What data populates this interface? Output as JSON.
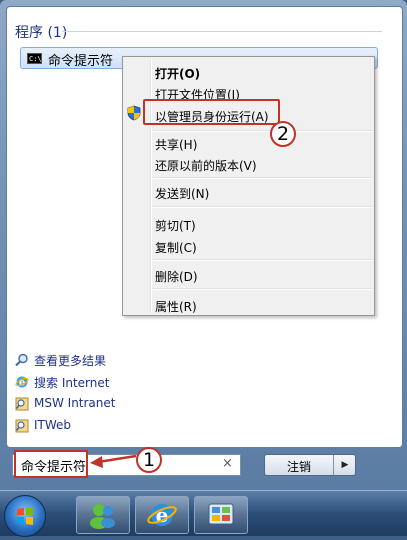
{
  "start_menu": {
    "section_header": "程序 (1)",
    "program_item": {
      "label": "命令提示符",
      "icon_text": "C:\\"
    }
  },
  "context_menu": {
    "items": [
      {
        "label": "打开(O)",
        "bold": true
      },
      {
        "label": "打开文件位置(I)"
      },
      {
        "label": "以管理员身份运行(A)",
        "icon": "uac-shield-icon",
        "highlighted": true
      },
      {
        "label": "共享(H)"
      },
      {
        "label": "还原以前的版本(V)"
      },
      {
        "label": "发送到(N)"
      },
      {
        "label": "剪切(T)"
      },
      {
        "label": "复制(C)"
      },
      {
        "label": "删除(D)"
      },
      {
        "label": "属性(R)"
      }
    ]
  },
  "links": [
    {
      "label": "查看更多结果",
      "icon": "search-icon"
    },
    {
      "label": "搜索 Internet",
      "icon": "internet-explorer-icon"
    },
    {
      "label": "MSW Intranet",
      "icon": "intranet-search-icon"
    },
    {
      "label": "ITWeb",
      "icon": "web-search-icon"
    }
  ],
  "search": {
    "value": "命令提示符",
    "clear_icon": "×"
  },
  "shutdown": {
    "label": "注销",
    "arrow": "▶"
  },
  "callouts": {
    "first": "1",
    "second": "2"
  },
  "taskbar": {
    "items": [
      "start-orb",
      "windows-live-messenger-icon",
      "internet-explorer-icon",
      "control-panel-icon"
    ]
  },
  "colors": {
    "highlight_red": "#c0332b",
    "link_blue": "#1e3287",
    "menu_bg": "#f0f0f0"
  }
}
